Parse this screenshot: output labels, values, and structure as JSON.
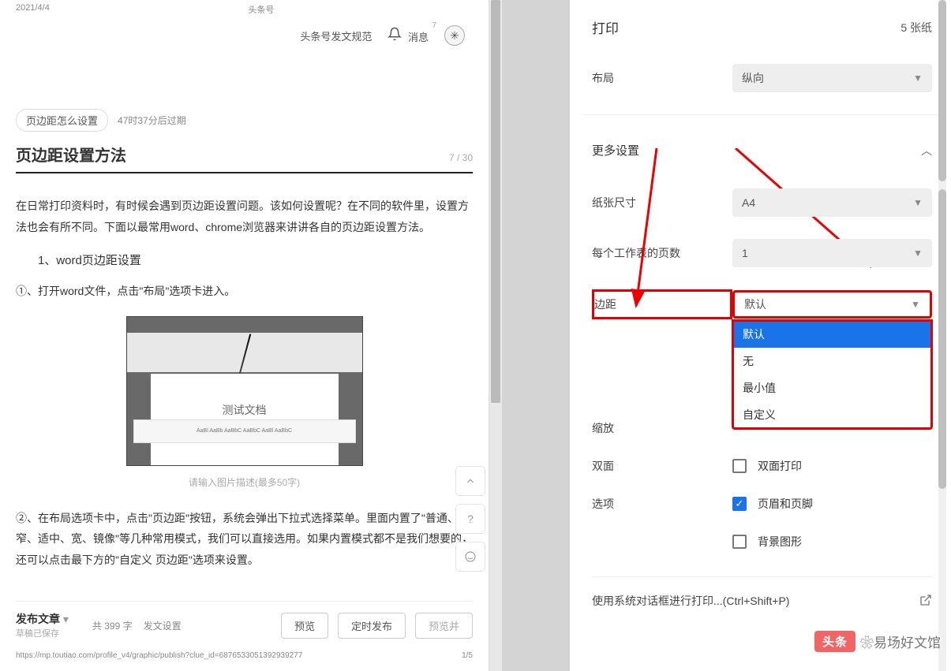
{
  "preview": {
    "date": "2021/4/4",
    "site": "头条号",
    "nav_rules": "头条号发文规范",
    "nav_msg": "消息",
    "msg_badge": "7",
    "tag": "页边距怎么设置",
    "expire": "47时37分后过期",
    "title": "页边距设置方法",
    "title_count": "7 / 30",
    "p1": "在日常打印资料时，有时候会遇到页边距设置问题。该如何设置呢？在不同的软件里，设置方法也会有所不同。下面以最常用word、chrome浏览器来讲讲各自的页边距设置方法。",
    "h2": "1、word页边距设置",
    "p2": "①、打开word文件，点击\"布局\"选项卡进入。",
    "word_doc_title": "测试文档",
    "word_styles": "AaBl  AaBb  AaBbC  AaBbC  AaBl  AaBbC",
    "caption": "请输入图片描述(最多50字)",
    "p3": "②、在布局选项卡中，点击\"页边距\"按钮，系统会弹出下拉式选择菜单。里面内置了\"普通、窄、适中、宽、镜像\"等几种常用模式，我们可以直接选用。如果内置模式都不是我们想要的，还可以点击最下方的\"自定义 页边距\"选项来设置。",
    "publish": "发布文章",
    "publish_sub": "草稿已保存",
    "word_count": "共 399 字",
    "pub_settings": "发文设置",
    "btn_preview": "预览",
    "btn_schedule": "定时发布",
    "btn_publish": "预览并",
    "url": "https://mp.toutiao.com/profile_v4/graphic/publish?clue_id=6876533051392939277",
    "page": "1/5"
  },
  "print": {
    "title": "打印",
    "sheets": "5 张纸",
    "layout_label": "布局",
    "layout_value": "纵向",
    "more": "更多设置",
    "paper_label": "纸张尺寸",
    "paper_value": "A4",
    "perpage_label": "每个工作表的页数",
    "perpage_value": "1",
    "margin_label": "边距",
    "margin_value": "默认",
    "dd_default": "默认",
    "dd_none": "无",
    "dd_min": "最小值",
    "dd_custom": "自定义",
    "scale_label": "缩放",
    "duplex_label": "双面",
    "duplex_opt": "双面打印",
    "options_label": "选项",
    "opt_header": "页眉和页脚",
    "opt_bg": "背景图形",
    "system": "使用系统对话框进行打印...(Ctrl+Shift+P)"
  },
  "watermark": {
    "badge": "头条",
    "user": "❀易场好文馆"
  }
}
